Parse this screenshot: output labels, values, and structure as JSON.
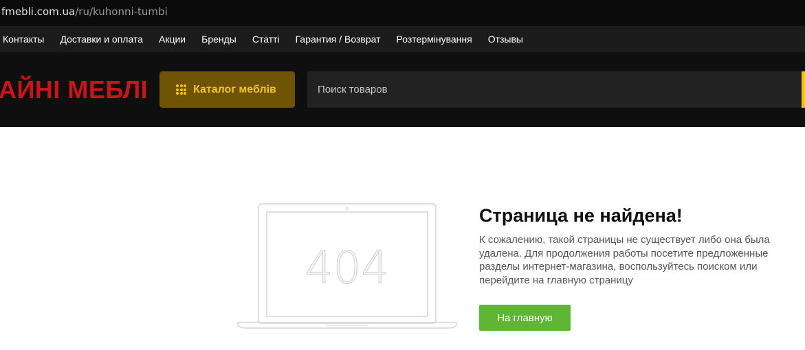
{
  "url": {
    "host": "fmebli.com.ua",
    "path": "/ru/kuhonni-tumbi"
  },
  "topnav": {
    "items": [
      {
        "label": "Контакты"
      },
      {
        "label": "Доставки и оплата"
      },
      {
        "label": "Акции"
      },
      {
        "label": "Бренды"
      },
      {
        "label": "Статті"
      },
      {
        "label": "Гарантия / Возврат"
      },
      {
        "label": "Розтермінування"
      },
      {
        "label": "Отзывы"
      }
    ]
  },
  "header": {
    "logo_text": "АЙНІ МЕБЛІ",
    "catalog_label": "Каталог меблів",
    "catalog_icon": "grid-dots-icon",
    "search_placeholder": "Поиск товаров"
  },
  "error": {
    "illustration_text": "404",
    "title": "Страница не найдена!",
    "text": "К сожалению, такой страницы не существует либо она была удалена. Для продолжения работы посетите предложенные разделы интернет-магазина, воспользуйтесь поиском или перейдите на главную страницу",
    "home_button_label": "На главную"
  },
  "colors": {
    "logo": "#c8151c",
    "catalog_bg": "#6e5404",
    "accent_yellow": "#f5c21a",
    "home_button": "#5fb534"
  }
}
